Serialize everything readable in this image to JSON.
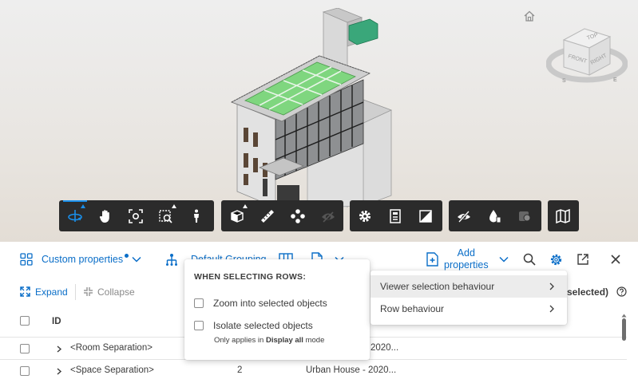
{
  "viewcube": {
    "top": "TOP",
    "front": "FRONT",
    "right": "RIGHT",
    "compass_s": "S",
    "compass_e": "E"
  },
  "toolbar": {
    "groups": [
      [
        "orbit-icon",
        "pan-icon",
        "fit-to-view-icon",
        "zoom-window-icon",
        "first-person-icon"
      ],
      [
        "section-box-icon",
        "measure-icon",
        "explode-icon",
        "hide-visibility-icon"
      ],
      [
        "settings-icon",
        "properties-panel-icon",
        "fullscreen-icon"
      ],
      [
        "hide-objects-icon",
        "isolate-objects-icon",
        "ghost-objects-icon"
      ],
      [
        "map-icon"
      ]
    ],
    "accent": "#1a8ee8"
  },
  "panel": {
    "custom_properties": "Custom properties",
    "default_grouping": "Default Grouping",
    "add_properties": [
      "Add",
      "properties"
    ],
    "expand": "Expand",
    "collapse": "Collapse",
    "selected_text": "0 selected)",
    "id_header": "ID",
    "rows": [
      {
        "name": "<Room Separation>",
        "col2": "",
        "col3": "2020..."
      },
      {
        "name": "<Space Separation>",
        "col2": "2",
        "col3": "Urban House - 2020..."
      }
    ],
    "accent": "#0a6ec8"
  },
  "selection_popup": {
    "heading": "WHEN SELECTING ROWS:",
    "zoom_label": "Zoom into selected objects",
    "isolate_label": "Isolate selected objects",
    "note_prefix": "Only applies in ",
    "note_bold": "Display all",
    "note_suffix": " mode"
  },
  "settings_menu": {
    "items": [
      "Viewer selection behaviour",
      "Row behaviour"
    ]
  }
}
